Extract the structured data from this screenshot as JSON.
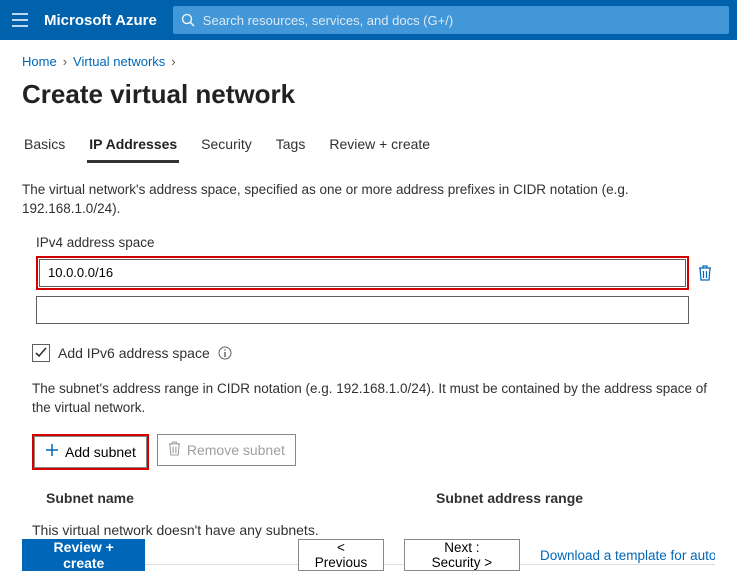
{
  "header": {
    "brand": "Microsoft Azure",
    "search_placeholder": "Search resources, services, and docs (G+/)"
  },
  "breadcrumb": {
    "home": "Home",
    "vnets": "Virtual networks"
  },
  "page_title": "Create virtual network",
  "tabs": {
    "basics": "Basics",
    "ip": "IP Addresses",
    "security": "Security",
    "tags": "Tags",
    "review": "Review + create"
  },
  "ip_section": {
    "desc": "The virtual network's address space, specified as one or more address prefixes in CIDR notation (e.g. 192.168.1.0/24).",
    "label": "IPv4 address space",
    "value": "10.0.0.0/16",
    "ipv6_checkbox": "Add IPv6 address space"
  },
  "subnet_section": {
    "desc": "The subnet's address range in CIDR notation (e.g. 192.168.1.0/24). It must be contained by the address space of the virtual network.",
    "add": "Add subnet",
    "remove": "Remove subnet",
    "col_name": "Subnet name",
    "col_range": "Subnet address range",
    "empty": "This virtual network doesn't have any subnets."
  },
  "footer": {
    "review": "Review + create",
    "prev": "< Previous",
    "next": "Next : Security >",
    "template_link": "Download a template for automati"
  }
}
